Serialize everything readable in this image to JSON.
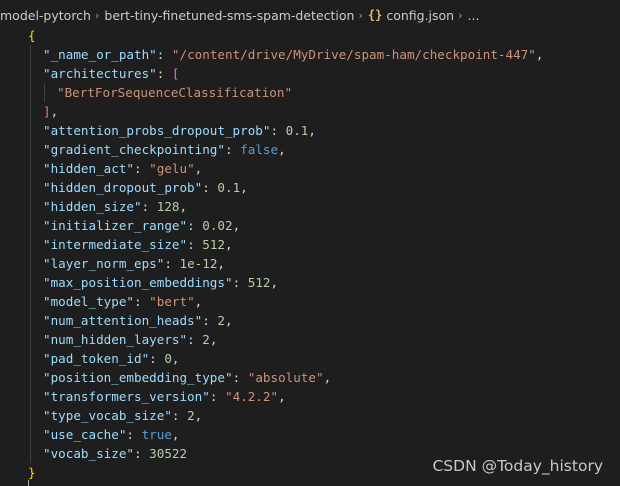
{
  "breadcrumb": {
    "items": [
      "model-pytorch",
      "bert-tiny-finetuned-sms-spam-detection",
      "config.json",
      "..."
    ],
    "file_icon": "{}"
  },
  "config": {
    "open_brace": "{",
    "close_brace": "}",
    "name_or_path": {
      "key": "\"_name_or_path\"",
      "value": "\"/content/drive/MyDrive/spam-ham/checkpoint-447\""
    },
    "architectures": {
      "key": "\"architectures\"",
      "open": "[",
      "item": "\"BertForSequenceClassification\"",
      "close": "]"
    },
    "entries": [
      {
        "key": "\"attention_probs_dropout_prob\"",
        "value": "0.1",
        "kind": "num"
      },
      {
        "key": "\"gradient_checkpointing\"",
        "value": "false",
        "kind": "kw"
      },
      {
        "key": "\"hidden_act\"",
        "value": "\"gelu\"",
        "kind": "str"
      },
      {
        "key": "\"hidden_dropout_prob\"",
        "value": "0.1",
        "kind": "num"
      },
      {
        "key": "\"hidden_size\"",
        "value": "128",
        "kind": "num"
      },
      {
        "key": "\"initializer_range\"",
        "value": "0.02",
        "kind": "num"
      },
      {
        "key": "\"intermediate_size\"",
        "value": "512",
        "kind": "num"
      },
      {
        "key": "\"layer_norm_eps\"",
        "value": "1e-12",
        "kind": "num"
      },
      {
        "key": "\"max_position_embeddings\"",
        "value": "512",
        "kind": "num"
      },
      {
        "key": "\"model_type\"",
        "value": "\"bert\"",
        "kind": "str"
      },
      {
        "key": "\"num_attention_heads\"",
        "value": "2",
        "kind": "num"
      },
      {
        "key": "\"num_hidden_layers\"",
        "value": "2",
        "kind": "num"
      },
      {
        "key": "\"pad_token_id\"",
        "value": "0",
        "kind": "num"
      },
      {
        "key": "\"position_embedding_type\"",
        "value": "\"absolute\"",
        "kind": "str"
      },
      {
        "key": "\"transformers_version\"",
        "value": "\"4.2.2\"",
        "kind": "str"
      },
      {
        "key": "\"type_vocab_size\"",
        "value": "2",
        "kind": "num"
      },
      {
        "key": "\"use_cache\"",
        "value": "true",
        "kind": "kw"
      },
      {
        "key": "\"vocab_size\"",
        "value": "30522",
        "kind": "num",
        "last": true
      }
    ]
  },
  "watermark": "CSDN @Today_history",
  "colors": {
    "background": "#1e1e1e",
    "json_key": "#9cdcfe",
    "json_string": "#ce9178",
    "json_number": "#b5cea8",
    "json_keyword": "#569cd6",
    "brace": "#ffd700",
    "bracket": "#da70d6"
  }
}
